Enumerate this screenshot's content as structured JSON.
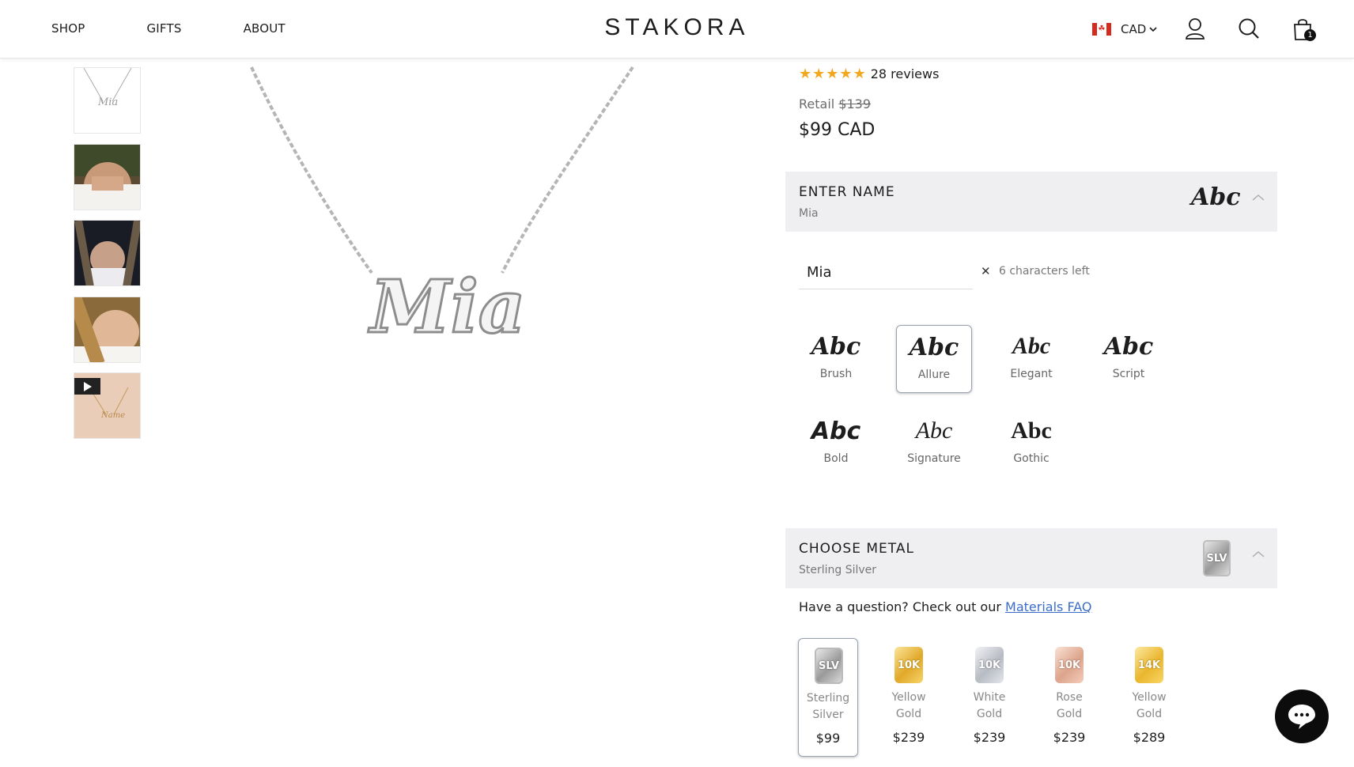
{
  "header": {
    "nav": [
      "SHOP",
      "GIFTS",
      "ABOUT"
    ],
    "logo": "STAKORA",
    "currency": "CAD",
    "cart_count": "1"
  },
  "product": {
    "review_count": "28 reviews",
    "retail_label": "Retail",
    "retail_price": "$139",
    "price": "$99 CAD",
    "preview_name": "Mia",
    "rating": 5
  },
  "name_section": {
    "title": "ENTER NAME",
    "value": "Mia",
    "icon_text": "Abc",
    "input_value": "Mia",
    "chars_left": "6 characters left"
  },
  "fonts": [
    {
      "sample": "Abc",
      "label": "Brush"
    },
    {
      "sample": "Abc",
      "label": "Allure"
    },
    {
      "sample": "Abc",
      "label": "Elegant"
    },
    {
      "sample": "Abc",
      "label": "Script"
    },
    {
      "sample": "Abc",
      "label": "Bold"
    },
    {
      "sample": "Abc",
      "label": "Signature"
    },
    {
      "sample": "Abc",
      "label": "Gothic"
    }
  ],
  "selected_font": "Allure",
  "metal_section": {
    "title": "CHOOSE METAL",
    "value": "Sterling Silver",
    "icon_text": "SLV",
    "faq_prefix": "Have a question? Check out our",
    "faq_link": "Materials FAQ"
  },
  "metals": [
    {
      "code": "SLV",
      "name_line1": "Sterling",
      "name_line2": "Silver",
      "price": "$99",
      "color": "#a9a9a9"
    },
    {
      "code": "10K",
      "name_line1": "Yellow",
      "name_line2": "Gold",
      "price": "$239",
      "color": "#e7b93c"
    },
    {
      "code": "10K",
      "name_line1": "White",
      "name_line2": "Gold",
      "price": "$239",
      "color": "#c3c6cc"
    },
    {
      "code": "10K",
      "name_line1": "Rose",
      "name_line2": "Gold",
      "price": "$239",
      "color": "#e6b39c"
    },
    {
      "code": "14K",
      "name_line1": "Yellow",
      "name_line2": "Gold",
      "price": "$289",
      "color": "#f0c440"
    }
  ],
  "selected_metal": "Sterling Silver",
  "colors": {
    "star": "#f2a81d",
    "link": "#3b6cc9",
    "section_bg": "#efeff1"
  }
}
